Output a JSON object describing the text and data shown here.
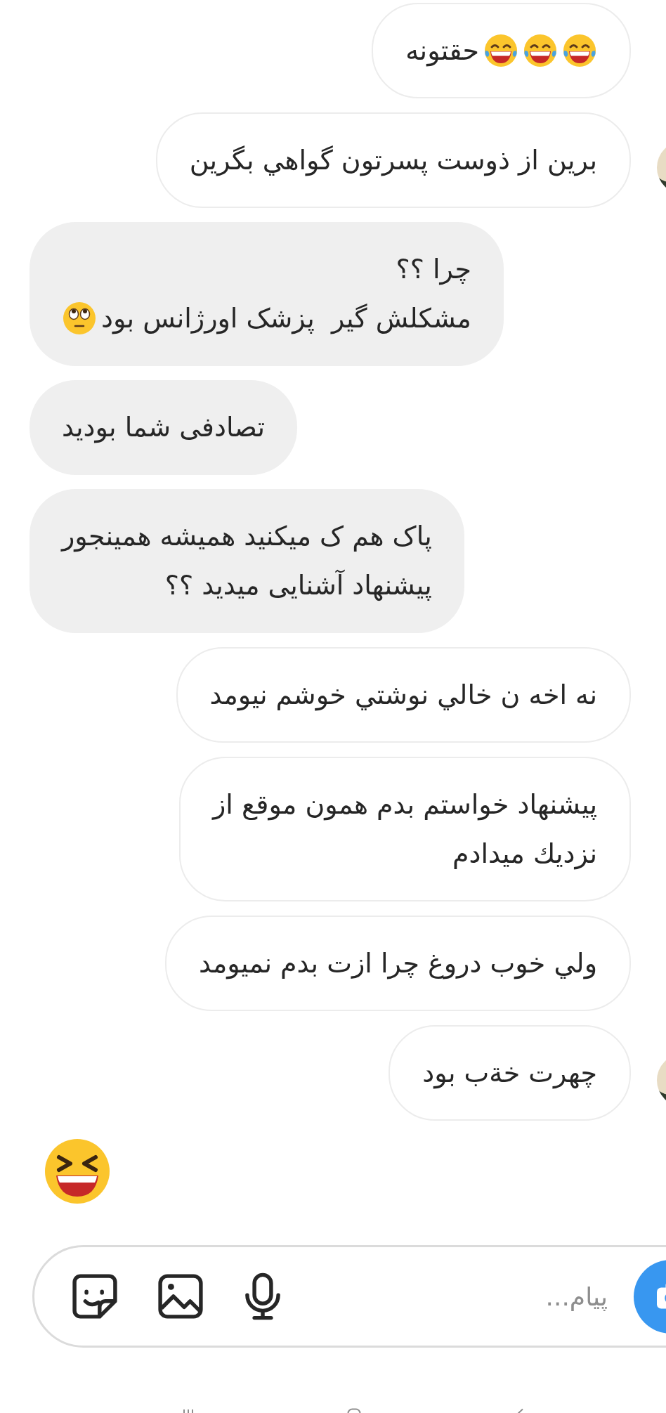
{
  "messages": [
    {
      "kind": "outlined",
      "avatar": false,
      "lines": [
        [
          {
            "kind": "laugh"
          },
          {
            "kind": "laugh"
          },
          {
            "kind": "laugh"
          },
          {
            "kind": "text",
            "text": "حقتونه"
          }
        ]
      ]
    },
    {
      "kind": "outlined",
      "avatar": true,
      "lines": [
        [
          {
            "kind": "text",
            "text": "برین از ذوست پسرتون گواهي بگرين"
          }
        ]
      ]
    },
    {
      "kind": "filled",
      "lines": [
        [
          {
            "kind": "text",
            "text": "چرا ؟؟"
          }
        ],
        [
          {
            "kind": "text",
            "text": "مشکلش گیر  پزشک اورژانس بود"
          },
          {
            "kind": "eye-roll"
          }
        ]
      ]
    },
    {
      "kind": "filled",
      "lines": [
        [
          {
            "kind": "text",
            "text": "تصادفی شما بودید"
          }
        ]
      ]
    },
    {
      "kind": "filled",
      "lines": [
        [
          {
            "kind": "text",
            "text": "پاک هم ک میکنید همیشه همینجور\nپیشنهاد آشنایی میدید ؟؟"
          }
        ]
      ]
    },
    {
      "kind": "outlined",
      "avatar": false,
      "lines": [
        [
          {
            "kind": "text",
            "text": "نه اخه ن خالي نوشتي خوشم نيومد"
          }
        ]
      ]
    },
    {
      "kind": "outlined",
      "avatar": false,
      "lines": [
        [
          {
            "kind": "text",
            "text": "پيشنهاد خواستم بدم همون موقع از\nنزديك ميدادم"
          }
        ]
      ]
    },
    {
      "kind": "outlined",
      "avatar": false,
      "lines": [
        [
          {
            "kind": "text",
            "text": "ولي خوب دروغ چرا ازت بدم نميومد"
          }
        ]
      ]
    },
    {
      "kind": "outlined",
      "avatar": true,
      "lines": [
        [
          {
            "kind": "text",
            "text": "چهرت خةب بود"
          }
        ]
      ]
    },
    {
      "kind": "emoji",
      "lines": [
        [
          {
            "kind": "squint"
          }
        ]
      ]
    }
  ],
  "composer": {
    "placeholder": "پیام..."
  }
}
